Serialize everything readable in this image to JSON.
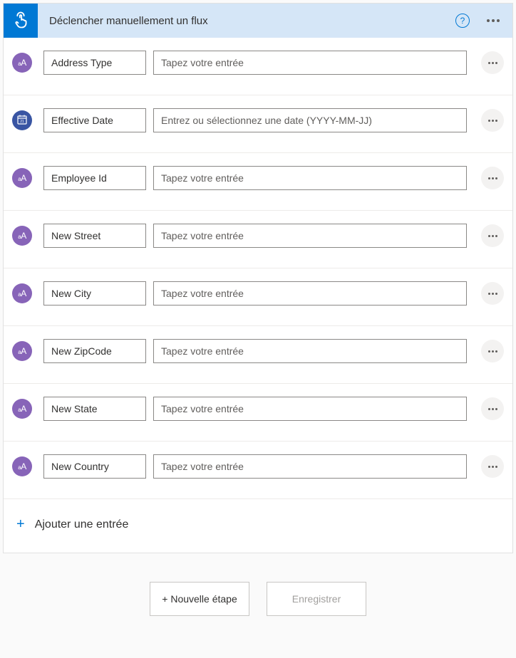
{
  "header": {
    "title": "Déclencher manuellement un flux"
  },
  "rows": [
    {
      "icon": "text",
      "label": "Address Type",
      "placeholder": "Tapez votre entrée"
    },
    {
      "icon": "date",
      "label": "Effective Date",
      "placeholder": "Entrez ou sélectionnez une date (YYYY-MM-JJ)"
    },
    {
      "icon": "text",
      "label": "Employee Id",
      "placeholder": "Tapez votre entrée"
    },
    {
      "icon": "text",
      "label": "New Street",
      "placeholder": "Tapez votre entrée"
    },
    {
      "icon": "text",
      "label": "New City",
      "placeholder": "Tapez votre entrée"
    },
    {
      "icon": "text",
      "label": "New ZipCode",
      "placeholder": "Tapez votre entrée"
    },
    {
      "icon": "text",
      "label": "New State",
      "placeholder": "Tapez votre entrée"
    },
    {
      "icon": "text",
      "label": "New Country",
      "placeholder": "Tapez votre entrée"
    }
  ],
  "addInput": {
    "label": "Ajouter une entrée"
  },
  "footer": {
    "newStep": "+ Nouvelle étape",
    "save": "Enregistrer"
  }
}
